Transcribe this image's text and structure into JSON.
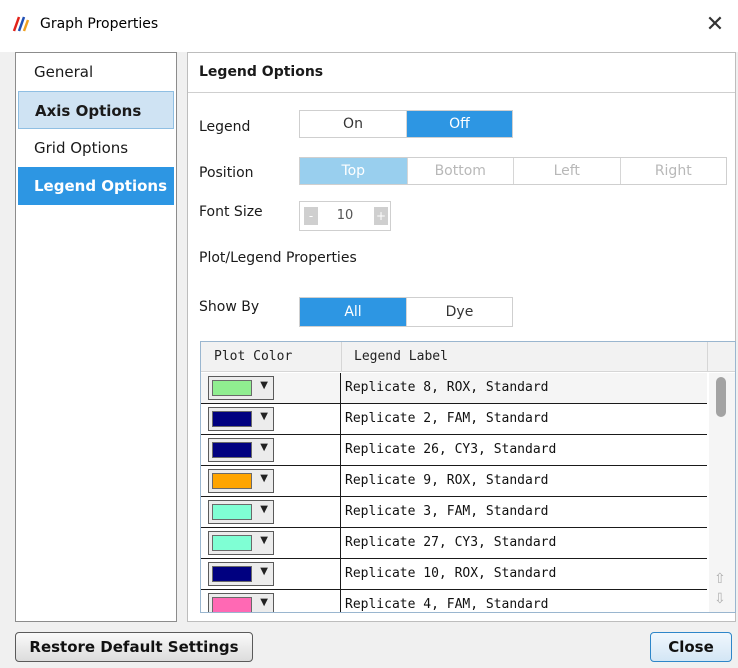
{
  "window": {
    "title": "Graph Properties",
    "close_glyph": "✕"
  },
  "sidebar": {
    "items": [
      {
        "label": "General"
      },
      {
        "label": "Axis Options"
      },
      {
        "label": "Grid Options"
      },
      {
        "label": "Legend Options"
      }
    ],
    "selected": "Legend Options"
  },
  "panel": {
    "header": "Legend Options",
    "legend": {
      "label": "Legend",
      "options": [
        "On",
        "Off"
      ],
      "selected": "Off"
    },
    "position": {
      "label": "Position",
      "options": [
        "Top",
        "Bottom",
        "Left",
        "Right"
      ],
      "selected": "Top",
      "enabled": false
    },
    "font_size": {
      "label": "Font Size",
      "value": "10",
      "minus": "-",
      "plus": "+"
    },
    "plot_legend_properties": "Plot/Legend Properties",
    "show_by": {
      "label": "Show By",
      "options": [
        "All",
        "Dye"
      ],
      "selected": "All"
    },
    "table": {
      "columns": [
        "Plot Color",
        "Legend Label"
      ],
      "rows": [
        {
          "color": "#90ee90",
          "label": "Replicate 8, ROX, Standard"
        },
        {
          "color": "#000080",
          "label": "Replicate 2, FAM, Standard"
        },
        {
          "color": "#000080",
          "label": "Replicate 26, CY3, Standard"
        },
        {
          "color": "#ffa500",
          "label": "Replicate 9, ROX, Standard"
        },
        {
          "color": "#7fffd4",
          "label": "Replicate 3, FAM, Standard"
        },
        {
          "color": "#7fffd4",
          "label": "Replicate 27, CY3, Standard"
        },
        {
          "color": "#000080",
          "label": "Replicate 10, ROX, Standard"
        },
        {
          "color": "#ff69b4",
          "label": "Replicate 4, FAM, Standard"
        }
      ]
    }
  },
  "footer": {
    "restore_label": "Restore Default Settings",
    "close_label": "Close"
  },
  "colors": {
    "accent": "#2d96e3",
    "accent_disabled": "#99cfee",
    "hover": "#cfe3f3"
  }
}
